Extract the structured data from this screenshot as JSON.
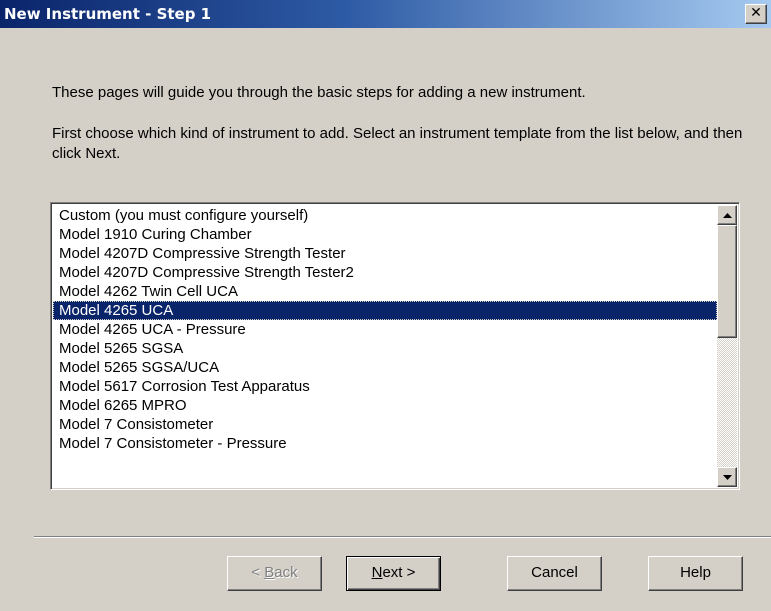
{
  "window": {
    "title": "New Instrument - Step 1",
    "close_glyph": "✕"
  },
  "content": {
    "intro": "These pages will guide you through the basic steps for adding a new instrument.",
    "instructions": "First choose which kind of instrument to add. Select an instrument template from the list below, and then click Next."
  },
  "list": {
    "selected_index": 5,
    "items": [
      "Custom (you must configure yourself)",
      "Model 1910 Curing Chamber",
      "Model 4207D Compressive Strength Tester",
      "Model 4207D Compressive Strength Tester2",
      "Model 4262 Twin Cell UCA",
      "Model 4265 UCA",
      "Model 4265 UCA - Pressure",
      "Model 5265 SGSA",
      "Model 5265 SGSA/UCA",
      "Model 5617 Corrosion Test Apparatus",
      "Model 6265 MPRO",
      "Model 7 Consistometer",
      "Model 7 Consistometer - Pressure"
    ]
  },
  "buttons": {
    "back": {
      "mnemonic": "B",
      "rest": "ack",
      "prefix": "< ",
      "enabled": false
    },
    "next": {
      "mnemonic": "N",
      "rest": "ext >",
      "enabled": true
    },
    "cancel": "Cancel",
    "help": "Help"
  },
  "colors": {
    "title_start": "#0a246a",
    "title_end": "#a6caf0",
    "selection": "#0a246a",
    "face": "#d4d0c8"
  }
}
